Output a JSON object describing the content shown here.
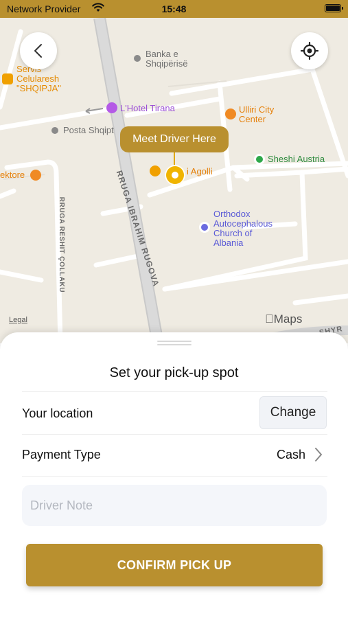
{
  "status_bar": {
    "carrier": "Network Provider",
    "time": "15:48"
  },
  "map": {
    "pois": {
      "banka_line1": "Banka e",
      "banka_line2": "Shqipërisë",
      "servis_line1": "Servis",
      "servis_line2": "Celularesh",
      "servis_line3": "\"SHQIPJA\"",
      "hotel": "L'Hotel Tirana",
      "ulliri_line1": "Ulliri City",
      "ulliri_line2": "Center",
      "posta": "Posta Shqipt",
      "sheshi": "Sheshi Austria",
      "ektore": "ektore",
      "agolli": "i Agolli",
      "church_line1": "Orthodox",
      "church_line2": "Autocephalous",
      "church_line3": "Church of",
      "church_line4": "Albania"
    },
    "streets": {
      "rugova": "RRUGA IBRAHIM RUGOVA",
      "collaku": "RRUGA RESHIT ÇOLLAKU",
      "corner": "SHYR"
    },
    "callout": "Meet Driver Here",
    "legal": "Legal",
    "maps_brand": "Maps",
    "icons": {
      "back": "chevron-left-icon",
      "locate": "crosshair-icon"
    },
    "accent_color": "#b9902f"
  },
  "sheet": {
    "title": "Set your pick-up spot",
    "location_label": "Your location",
    "change_button": "Change",
    "payment_label": "Payment Type",
    "payment_value": "Cash",
    "driver_note_placeholder": "Driver Note",
    "confirm_button": "CONFIRM PICK UP"
  }
}
